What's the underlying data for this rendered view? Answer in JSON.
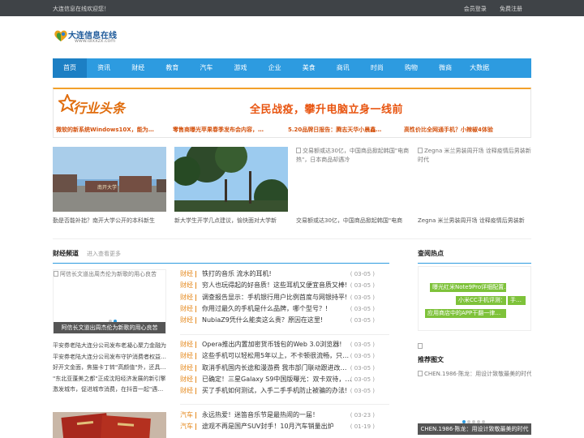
{
  "topbar": {
    "welcome": "大连信息在线欢迎您！",
    "login": "会员登录",
    "register": "免费注册"
  },
  "logo": {
    "name": "大连信息在线",
    "domain": "www.dlxxzx.com"
  },
  "nav": {
    "items": [
      "首页",
      "资讯",
      "财经",
      "教育",
      "汽车",
      "游戏",
      "企业",
      "美食",
      "商讯",
      "时尚",
      "购物",
      "微商",
      "大数据"
    ]
  },
  "banner": {
    "logo_text": "行业头条",
    "headline": "全民战疫，攀升电脑立身一线前",
    "subs": [
      "微软的新系统Windows10X，能为…",
      "零售商曝光苹果春季发布会内容，…",
      "5.20品牌日报告：腾志天华小晨鑫…",
      "高性价比全网通手机？小辣椒4体验"
    ]
  },
  "photos": {
    "campus_sign": "南开大学",
    "captions": [
      "勤是否能补拙？南开大学公开的本科新生",
      "新大学生开学几点建议，愉快面对大学新",
      "交易额或达30亿，中国商品掀起韩国\"电商",
      "Zegna 米兰男装周开场 诠释疫情后男装新"
    ],
    "alt3": "交易额或达30亿，中国商品掀起韩国\"电商热\"，日本商品却遇冷",
    "alt4": "Zegna 米兰男装周开场 诠释疫情后男装新时代"
  },
  "finance": {
    "title": "财经频道",
    "more": "进入查看更多",
    "slider_alt": "阿信长文道出周杰伦为新歌的用心良苦",
    "slider_caption": "阿信长文道出周杰伦为新歌的用心良苦",
    "side_news": [
      "平安券老陆大连分公司发布老凝心聚力金融为",
      "平安券老陆大连分公司发布守护消费者权益…",
      "好开文金面，焦猫卡丁转\"高颜值\"外，还具…",
      "\"东北亚蓬美之都\"正成沈阳经济发展的新引擎",
      "激发城市，促进城市消费，在抖音一起\"遇…"
    ],
    "news": [
      {
        "cat": "财经",
        "title": "铁打的音乐 流水的耳机!",
        "date": "( 03-05 )"
      },
      {
        "cat": "财经",
        "title": "穷人也玩得起的好音质！这些耳机又便宜音质又棒!",
        "date": "( 03-05 )"
      },
      {
        "cat": "财经",
        "title": "调查报告显示：手机银行用户比例首度与网银持平!",
        "date": "( 03-05 )"
      },
      {
        "cat": "财经",
        "title": "你用过最久的手机是什么品牌，哪个型号？!",
        "date": "( 03-05 )"
      },
      {
        "cat": "财经",
        "title": "NubiaZ9凭什么能卖这么贵？原因在这里!",
        "date": "( 03-05 )"
      },
      {
        "cat": "财经",
        "title": "Opera推出内置加密货币钱包的Web 3.0浏览器!",
        "date": "( 03-05 )"
      },
      {
        "cat": "财经",
        "title": "这些手机可以轻松用5年以上，不卡顿很流畅，只…",
        "date": "( 03-05 )"
      },
      {
        "cat": "财经",
        "title": "取消手机国内长途和漫游费 我市部门联动跟进改…",
        "date": "( 03-05 )"
      },
      {
        "cat": "财经",
        "title": "已确定！三星Galaxy S9中国版曝光：双卡双待，…",
        "date": "( 03-05 )"
      },
      {
        "cat": "财经",
        "title": "买了手机如何测试，入手二手手机防止被骗的办法!",
        "date": "( 03-05 )"
      }
    ],
    "news2": [
      {
        "cat": "汽车",
        "title": "永远热爱！迷笛音乐节是最热闹的一届！",
        "date": "( 03-23 )"
      },
      {
        "cat": "汽车",
        "title": "途观不再是国产SUV封手！10月汽车销量出炉",
        "date": "( 01-19 )"
      }
    ]
  },
  "hot": {
    "title": "查阅热点",
    "tags": [
      "曝光红米Note9Pro详细配置…",
      "小米CC手机评测：99…",
      "手…",
      "应用商店中的APP干翻一律…"
    ]
  },
  "recommend": {
    "title": "推荐图文",
    "alt": "CHEN.1986·陈龙：用设计致敬最美的时代",
    "caption": "CHEN.1986·陈龙：用设计致敬最美的时代"
  },
  "colors": {
    "nav": "#2d9be0",
    "accent_orange": "#e8540f",
    "topbar": "#3f4347",
    "tag_green": "#7ec23a"
  }
}
